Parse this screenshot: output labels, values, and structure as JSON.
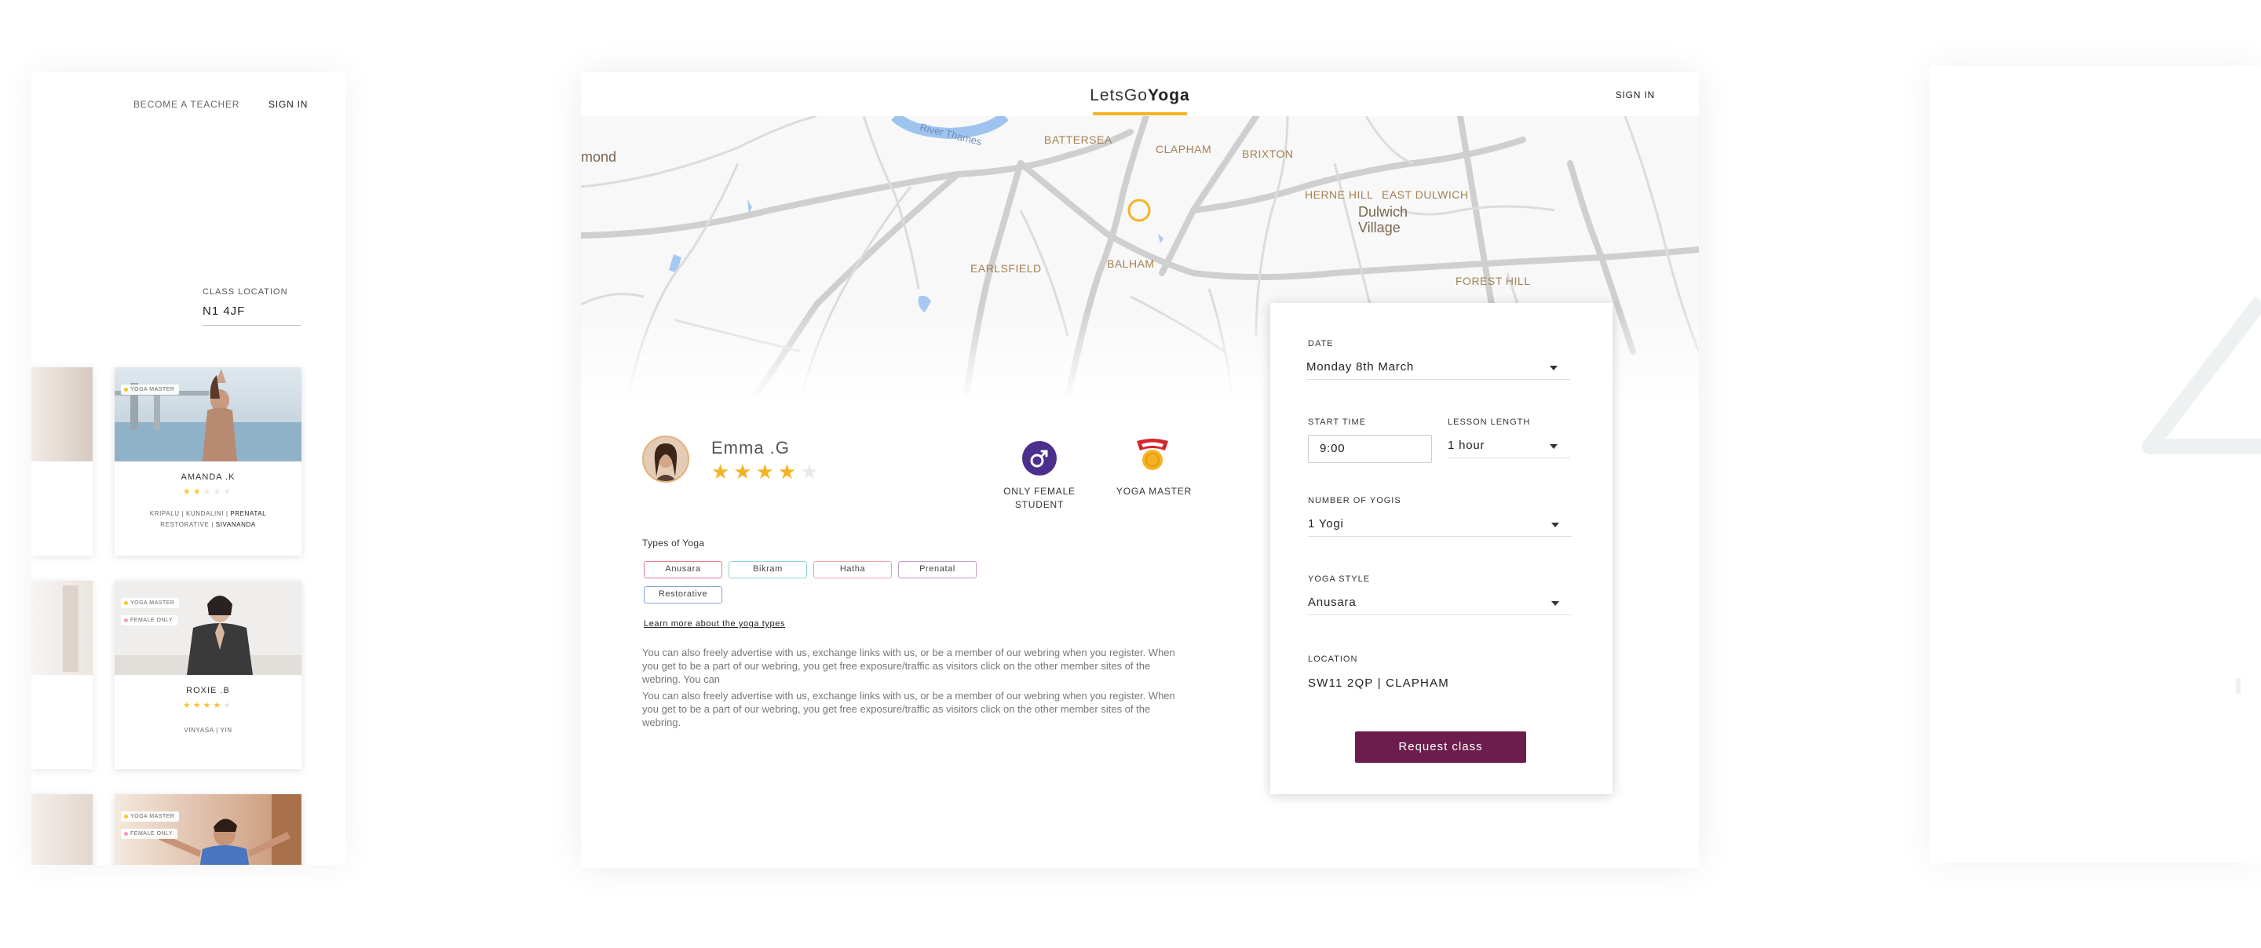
{
  "left_panel": {
    "nav": {
      "become_teacher": "BECOME A TEACHER",
      "sign_in": "SIGN IN"
    },
    "class_location": {
      "label": "CLASS LOCATION",
      "value": "N1 4JF"
    },
    "teachers": [
      {
        "name": "AMANDA .K",
        "tags": [
          "YOGA MASTER"
        ],
        "rating": 2,
        "styles_line1": [
          "KRIPALU",
          "KUNDALINI",
          "PRENATAL"
        ],
        "styles_line2": [
          "RESTORATIVE",
          "SIVANANDA"
        ]
      },
      {
        "name": "ROXIE .B",
        "tags": [
          "YOGA MASTER",
          "FEMALE ONLY"
        ],
        "rating": 4,
        "styles_line1": [
          "VINYASA",
          "YIN"
        ]
      },
      {
        "name": "",
        "tags": [
          "YOGA MASTER",
          "FEMALE ONLY"
        ]
      }
    ]
  },
  "main": {
    "brand_light": "LetsGo",
    "brand_bold": "Yoga",
    "sign_in": "SIGN IN",
    "map_labels": {
      "river": "River Thames",
      "mond": "mond",
      "battersea": "BATTERSEA",
      "clapham": "CLAPHAM",
      "brixton": "BRIXTON",
      "herne_hill": "HERNE HILL",
      "east_dulwich": "EAST DULWICH",
      "dulwich_village": "Dulwich Village",
      "earlsfield": "EARLSFIELD",
      "balham": "BALHAM",
      "forest_hill": "FOREST HILL"
    },
    "teacher": {
      "name": "Emma .G",
      "rating": 4,
      "max_rating": 5
    },
    "badges": [
      {
        "icon": "male-symbol-icon",
        "label_line1": "ONLY FEMALE",
        "label_line2": "STUDENT",
        "color": "#4b2f8c"
      },
      {
        "icon": "medal-icon",
        "label_line1": "YOGA MASTER",
        "label_line2": "",
        "color": "#d7262d"
      }
    ],
    "yoga_types_label": "Types of Yoga",
    "yoga_types": [
      {
        "name": "Anusara",
        "color": "#e8798a"
      },
      {
        "name": "Bikram",
        "color": "#8fd6d8"
      },
      {
        "name": "Hatha",
        "color": "#f0a0aa"
      },
      {
        "name": "Prenatal",
        "color": "#c59ad0"
      },
      {
        "name": "Restorative",
        "color": "#7fa6d8"
      }
    ],
    "learn_more": "Learn more about the yoga types",
    "description": [
      "You can also freely advertise with us, exchange links with us, or be a member of our webring when you register. When you get to be a part of our webring, you get free exposure/traffic as visitors click on the other member sites of the webring. You can",
      "You can also freely advertise with us, exchange links with us, or be a member of our webring when you register. When you get to be a part of our webring, you get free exposure/traffic as visitors click on the other member sites of the webring."
    ]
  },
  "form": {
    "date": {
      "label": "DATE",
      "value": "Monday 8th March"
    },
    "start_time": {
      "label": "START TIME",
      "value": "9:00"
    },
    "lesson_length": {
      "label": "LESSON LENGTH",
      "value": "1 hour"
    },
    "number_of_yogis": {
      "label": "NUMBER OF YOGIS",
      "value": "1 Yogi"
    },
    "yoga_style": {
      "label": "YOGA STYLE",
      "value": "Anusara"
    },
    "location": {
      "label": "LOCATION",
      "value": "SW11 2QP | CLAPHAM"
    },
    "submit": "Request class"
  },
  "colors": {
    "accent": "#f5b324",
    "button": "#6b1d4d",
    "star": "#f5b324"
  }
}
